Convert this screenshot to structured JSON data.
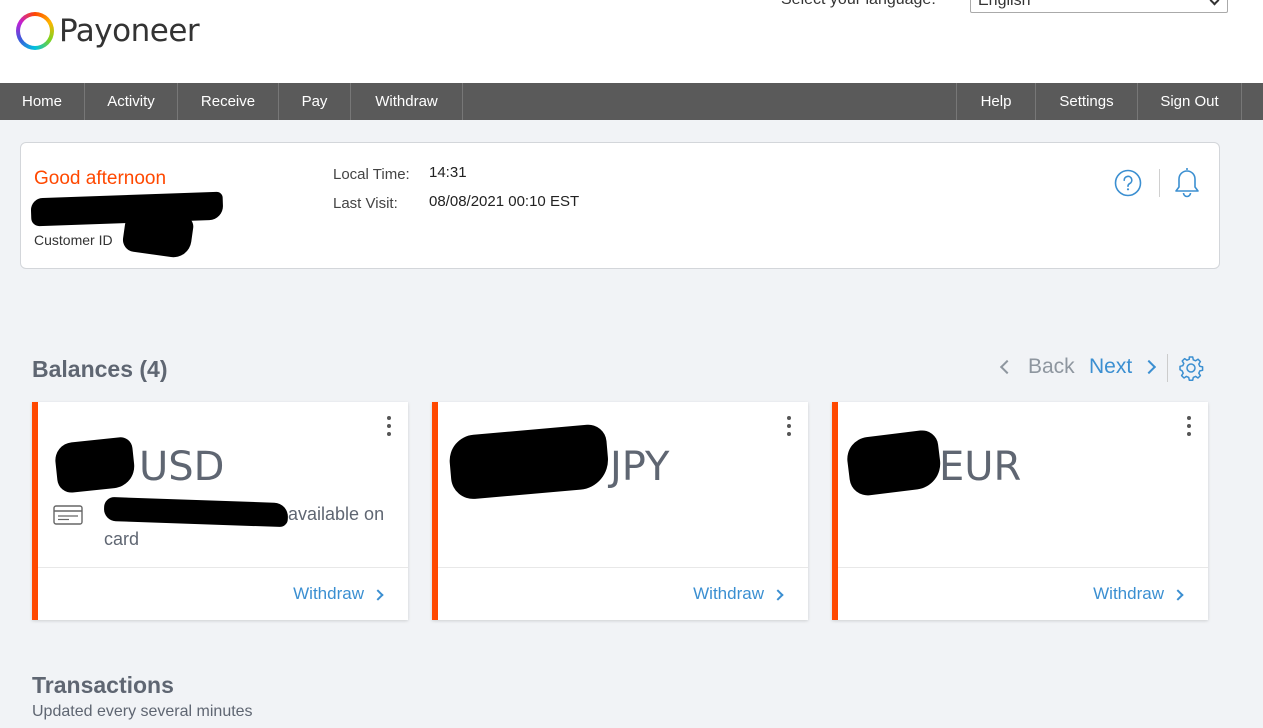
{
  "brand": {
    "name": "Payoneer",
    "accent": "#ff4800",
    "link_color": "#3b8fd1"
  },
  "language": {
    "label": "Select your language:",
    "selected": "English"
  },
  "nav": {
    "left": [
      "Home",
      "Activity",
      "Receive",
      "Pay",
      "Withdraw"
    ],
    "right": [
      "Help",
      "Settings",
      "Sign Out"
    ]
  },
  "greeting_card": {
    "greeting": "Good afternoon",
    "customer_id_label": "Customer ID",
    "local_time_label": "Local Time:",
    "local_time_value": "14:31",
    "last_visit_label": "Last Visit:",
    "last_visit_value": "08/08/2021 00:10 EST",
    "icons": [
      "help-icon",
      "bell-icon"
    ]
  },
  "balances": {
    "title": "Balances (4)",
    "back_label": "Back",
    "next_label": "Next",
    "settings_icon": "gear-icon",
    "cards": [
      {
        "currency": "USD",
        "available_text": "available on card",
        "withdraw_label": "Withdraw"
      },
      {
        "currency": "JPY",
        "withdraw_label": "Withdraw"
      },
      {
        "currency": "EUR",
        "withdraw_label": "Withdraw"
      }
    ]
  },
  "transactions": {
    "title": "Transactions",
    "subtitle": "Updated every several minutes"
  }
}
